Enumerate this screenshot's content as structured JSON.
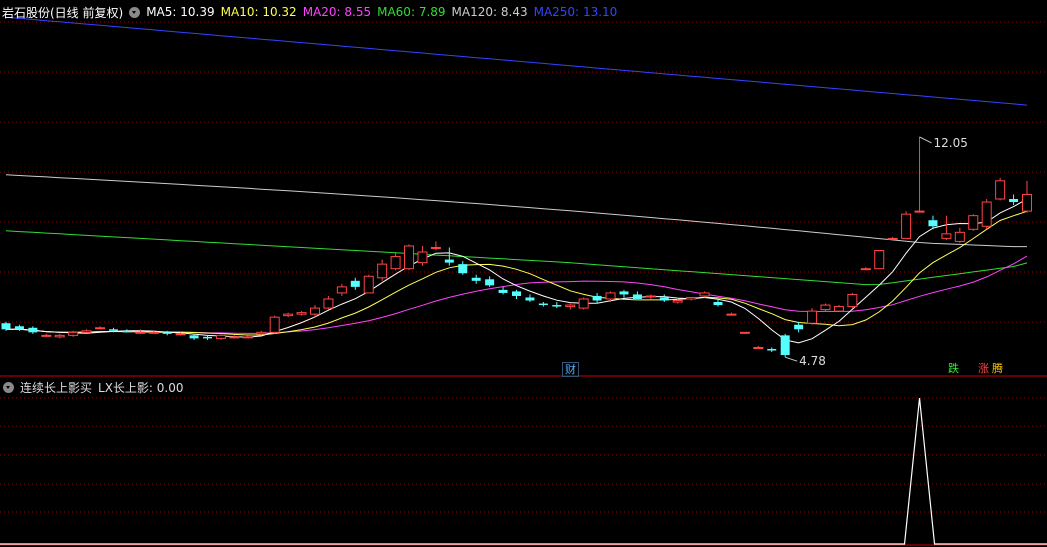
{
  "main_header": {
    "title": "岩石股份(日线 前复权)",
    "ma": [
      {
        "label": "MA5:",
        "value": "10.39",
        "color": "#ffffff"
      },
      {
        "label": "MA10:",
        "value": "10.32",
        "color": "#ffff55"
      },
      {
        "label": "MA20:",
        "value": "8.55",
        "color": "#ff44ff"
      },
      {
        "label": "MA60:",
        "value": "7.89",
        "color": "#33dd33"
      },
      {
        "label": "MA120:",
        "value": "8.43",
        "color": "#cccccc"
      },
      {
        "label": "MA250:",
        "value": "13.10",
        "color": "#3344ff"
      }
    ]
  },
  "annotations": {
    "high": "12.05",
    "low": "4.78"
  },
  "badges": {
    "cai": "财",
    "die": "跌",
    "zhang": "涨",
    "teng": "腾"
  },
  "sub_header": {
    "indicator": "连续长上影买",
    "series": "LX长上影:",
    "value": "0.00"
  },
  "colors": {
    "up": "#ff4444",
    "down": "#55ffff",
    "grid": "#990000",
    "frame": "#cc0000"
  },
  "chart_data": {
    "type": "candlestick",
    "series": [
      {
        "name": "MA5",
        "color": "#ffffff",
        "value": 10.39
      },
      {
        "name": "MA10",
        "color": "#ffff55",
        "value": 10.32
      },
      {
        "name": "MA20",
        "color": "#ff44ff",
        "value": 8.55
      },
      {
        "name": "MA60",
        "color": "#33dd33",
        "value": 7.89
      },
      {
        "name": "MA120",
        "color": "#cccccc",
        "value": 8.43
      },
      {
        "name": "MA250",
        "color": "#3344ff",
        "value": 13.1
      }
    ],
    "candles": [
      [
        5.9,
        5.7,
        5.95,
        5.65
      ],
      [
        5.8,
        5.7,
        5.85,
        5.65
      ],
      [
        5.75,
        5.6,
        5.8,
        5.55
      ],
      [
        5.5,
        5.5,
        5.55,
        5.45
      ],
      [
        5.45,
        5.5,
        5.55,
        5.4
      ],
      [
        5.5,
        5.6,
        5.65,
        5.45
      ],
      [
        5.6,
        5.65,
        5.7,
        5.6
      ],
      [
        5.75,
        5.75,
        5.8,
        5.7
      ],
      [
        5.7,
        5.65,
        5.75,
        5.6
      ],
      [
        5.65,
        5.6,
        5.7,
        5.6
      ],
      [
        5.6,
        5.6,
        5.7,
        5.55
      ],
      [
        5.6,
        5.6,
        5.65,
        5.55
      ],
      [
        5.6,
        5.55,
        5.65,
        5.5
      ],
      [
        5.55,
        5.55,
        5.6,
        5.5
      ],
      [
        5.5,
        5.4,
        5.55,
        5.35
      ],
      [
        5.45,
        5.4,
        5.5,
        5.35
      ],
      [
        5.4,
        5.5,
        5.55,
        5.35
      ],
      [
        5.45,
        5.45,
        5.5,
        5.4
      ],
      [
        5.45,
        5.45,
        5.5,
        5.4
      ],
      [
        5.55,
        5.6,
        5.65,
        5.5
      ],
      [
        5.6,
        6.1,
        6.15,
        5.55
      ],
      [
        6.15,
        6.2,
        6.25,
        6.1
      ],
      [
        6.2,
        6.25,
        6.3,
        6.15
      ],
      [
        6.2,
        6.4,
        6.5,
        6.1
      ],
      [
        6.4,
        6.7,
        6.8,
        6.35
      ],
      [
        6.9,
        7.1,
        7.2,
        6.8
      ],
      [
        7.3,
        7.1,
        7.4,
        7.0
      ],
      [
        6.9,
        7.45,
        7.5,
        6.9
      ],
      [
        7.4,
        7.85,
        8.0,
        7.3
      ],
      [
        7.7,
        8.1,
        8.25,
        7.65
      ],
      [
        7.7,
        8.45,
        8.5,
        7.65
      ],
      [
        7.9,
        8.25,
        8.45,
        7.8
      ],
      [
        8.4,
        8.4,
        8.6,
        8.3
      ],
      [
        8.0,
        7.9,
        8.4,
        7.8
      ],
      [
        7.85,
        7.55,
        7.95,
        7.5
      ],
      [
        7.4,
        7.3,
        7.5,
        7.2
      ],
      [
        7.35,
        7.15,
        7.45,
        7.1
      ],
      [
        7.0,
        6.9,
        7.1,
        6.85
      ],
      [
        6.95,
        6.8,
        7.0,
        6.7
      ],
      [
        6.75,
        6.65,
        6.85,
        6.6
      ],
      [
        6.55,
        6.5,
        6.6,
        6.45
      ],
      [
        6.5,
        6.45,
        6.6,
        6.4
      ],
      [
        6.45,
        6.5,
        6.55,
        6.35
      ],
      [
        6.4,
        6.7,
        6.75,
        6.35
      ],
      [
        6.8,
        6.65,
        6.9,
        6.55
      ],
      [
        6.7,
        6.9,
        6.95,
        6.6
      ],
      [
        6.95,
        6.85,
        7.0,
        6.75
      ],
      [
        6.85,
        6.7,
        6.95,
        6.7
      ],
      [
        6.8,
        6.8,
        6.85,
        6.7
      ],
      [
        6.75,
        6.65,
        6.85,
        6.6
      ],
      [
        6.6,
        6.65,
        6.7,
        6.55
      ],
      [
        6.7,
        6.75,
        6.75,
        6.65
      ],
      [
        6.8,
        6.9,
        6.95,
        6.75
      ],
      [
        6.6,
        6.5,
        6.7,
        6.45
      ],
      [
        6.2,
        6.2,
        6.25,
        6.2
      ],
      [
        5.6,
        5.6,
        5.6,
        5.6
      ],
      [
        5.1,
        5.1,
        5.15,
        5.05
      ],
      [
        5.05,
        5.0,
        5.1,
        4.95
      ],
      [
        5.5,
        4.85,
        5.55,
        4.78
      ],
      [
        5.85,
        5.7,
        5.95,
        5.6
      ],
      [
        5.9,
        6.3,
        6.4,
        5.85
      ],
      [
        6.35,
        6.5,
        6.55,
        6.3
      ],
      [
        6.3,
        6.45,
        6.5,
        6.3
      ],
      [
        6.45,
        6.85,
        6.9,
        6.4
      ],
      [
        7.7,
        7.7,
        7.75,
        7.65
      ],
      [
        7.7,
        8.3,
        8.3,
        7.7
      ],
      [
        8.7,
        8.7,
        8.75,
        8.65
      ],
      [
        8.7,
        9.5,
        9.6,
        8.7
      ],
      [
        9.6,
        9.6,
        12.05,
        9.55
      ],
      [
        9.3,
        9.1,
        9.45,
        9.0
      ],
      [
        8.7,
        8.85,
        9.45,
        8.65
      ],
      [
        8.6,
        8.9,
        9.05,
        8.55
      ],
      [
        9.0,
        9.45,
        9.5,
        8.95
      ],
      [
        9.1,
        9.9,
        10.0,
        9.0
      ],
      [
        10.0,
        10.6,
        10.7,
        9.95
      ],
      [
        10.0,
        9.9,
        10.15,
        9.8
      ],
      [
        9.6,
        10.15,
        10.6,
        9.55
      ]
    ],
    "indicator": {
      "name": "LX长上影",
      "values": "0 everywhere except a single spike at the 12.05 bar"
    }
  }
}
